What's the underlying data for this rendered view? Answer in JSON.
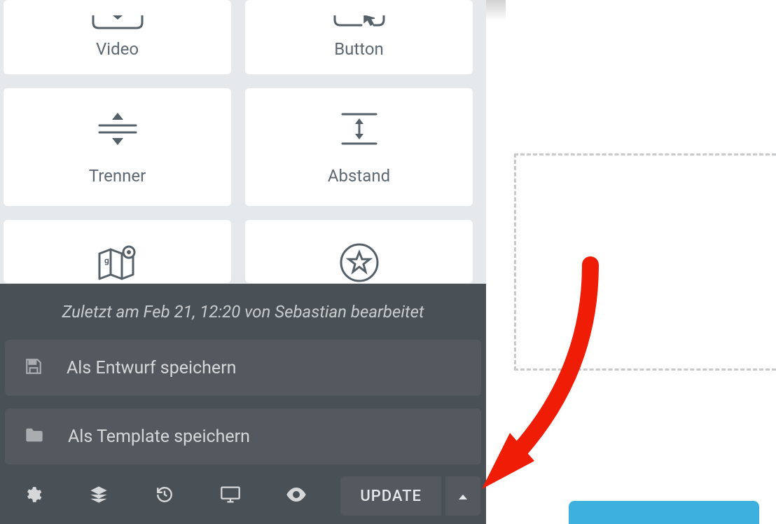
{
  "widgets": {
    "video": "Video",
    "button": "Button",
    "divider": "Trenner",
    "spacer": "Abstand"
  },
  "popup": {
    "last_edit": "Zuletzt am Feb 21, 12:20 von Sebastian bearbeitet",
    "save_draft": "Als Entwurf speichern",
    "save_template": "Als Template speichern"
  },
  "footer": {
    "update": "UPDATE"
  }
}
